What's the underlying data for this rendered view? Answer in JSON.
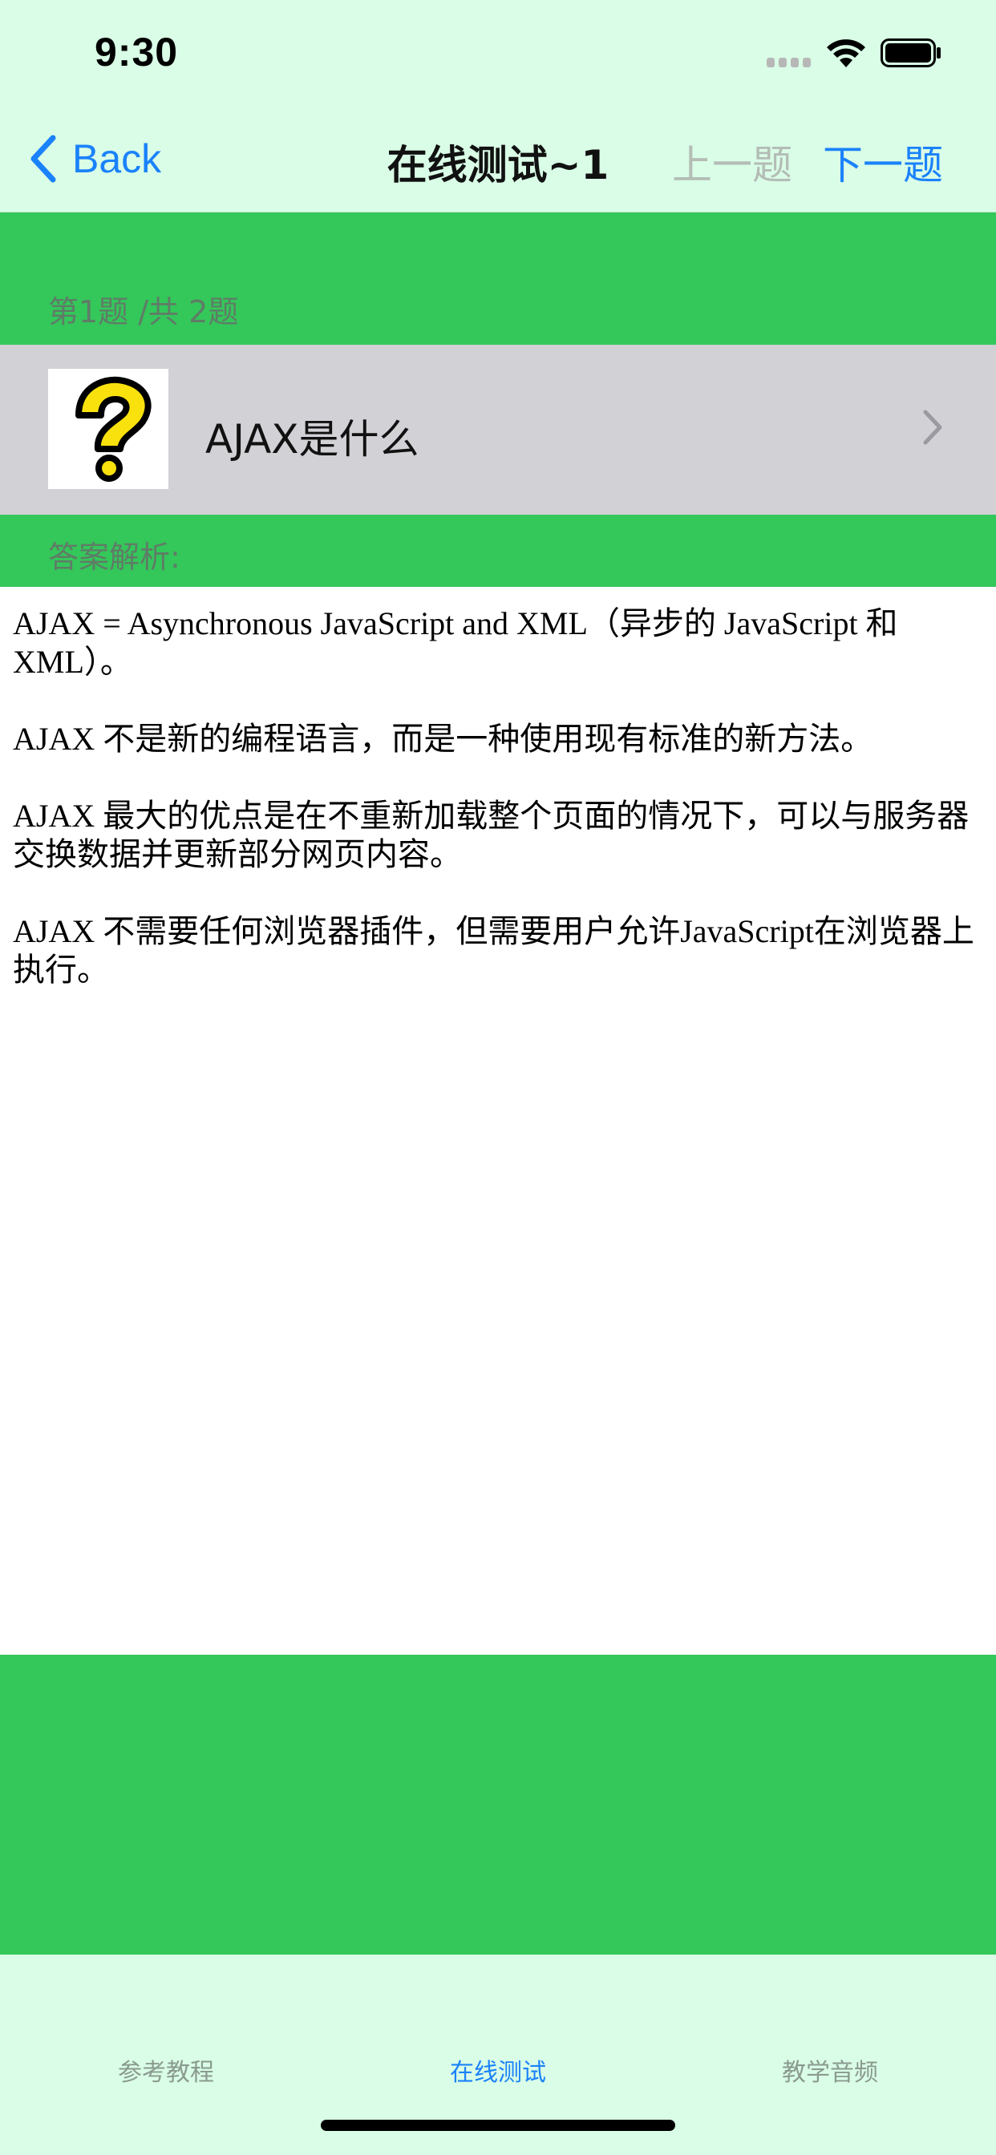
{
  "status_bar": {
    "time": "9:30"
  },
  "nav": {
    "back_label": "Back",
    "title": "在线测试~1",
    "prev_label": "上一题",
    "next_label": "下一题"
  },
  "question": {
    "counter": "第1题 /共 2题",
    "icon": "question-mark-icon",
    "text": "AJAX是什么"
  },
  "answer": {
    "label": "答案解析:",
    "paragraphs": [
      "AJAX = Asynchronous JavaScript and XML（异步的 JavaScript 和 XML）。",
      "AJAX 不是新的编程语言，而是一种使用现有标准的新方法。",
      "AJAX 最大的优点是在不重新加载整个页面的情况下，可以与服务器交换数据并更新部分网页内容。",
      "AJAX 不需要任何浏览器插件，但需要用户允许JavaScript在浏览器上执行。"
    ]
  },
  "tabs": [
    {
      "label": "参考教程",
      "active": false
    },
    {
      "label": "在线测试",
      "active": true
    },
    {
      "label": "教学音频",
      "active": false
    }
  ],
  "colors": {
    "bar_background": "#d9fde6",
    "green": "#34c75a",
    "row_gray": "#d1d1d6",
    "accent_blue": "#1a82fb",
    "disabled_gray": "#b4bcb6"
  }
}
